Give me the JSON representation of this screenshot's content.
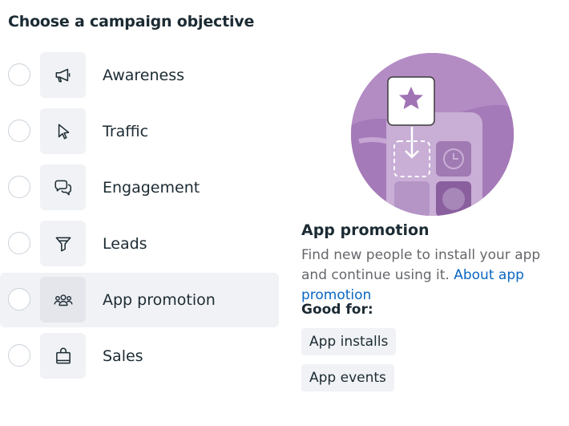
{
  "heading": "Choose a campaign objective",
  "objectives": [
    {
      "label": "Awareness",
      "icon": "megaphone-icon"
    },
    {
      "label": "Traffic",
      "icon": "cursor-icon"
    },
    {
      "label": "Engagement",
      "icon": "chat-bubbles-icon"
    },
    {
      "label": "Leads",
      "icon": "funnel-icon"
    },
    {
      "label": "App promotion",
      "icon": "people-icon",
      "selected": true
    },
    {
      "label": "Sales",
      "icon": "shopping-bag-icon"
    }
  ],
  "detail": {
    "title": "App promotion",
    "description": "Find new people to install your app and continue using it.",
    "link": "About app promotion",
    "good_for_label": "Good for:",
    "good_for": [
      "App installs",
      "App events"
    ],
    "illustration": "app-download-illustration"
  },
  "colors": {
    "selected_bg": "#f0f2f5",
    "icon_bg": "#f0f2f5",
    "link": "#0a66c2",
    "illustration_purple": "#b48cc4",
    "text": "#1c2b33",
    "secondary_text": "#65676b"
  }
}
